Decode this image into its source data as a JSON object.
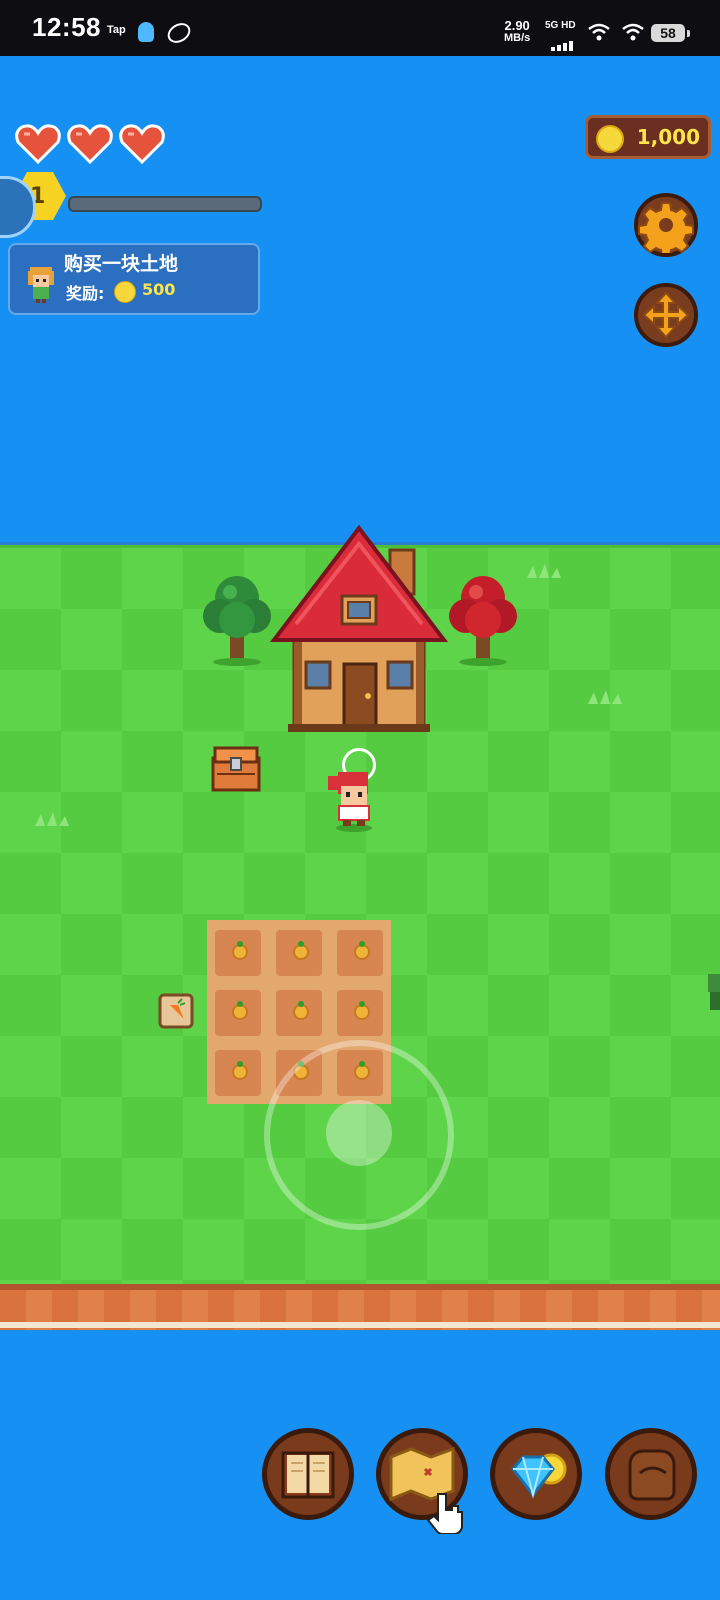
{
  "status_bar": {
    "time": "12:58",
    "tap_label": "Tap",
    "net_speed_value": "2.90",
    "net_speed_unit": "MB/s",
    "signal_label": "5G HD",
    "battery": "58"
  },
  "hud": {
    "hearts": 3,
    "level": "1",
    "xp_progress": 0,
    "coins": "1,000"
  },
  "quest": {
    "title": "购买一块土地",
    "reward_label": "奖励:",
    "reward_amount": "500"
  },
  "colors": {
    "water": "#1690f2",
    "grass": "#5ed44a",
    "soil": "#e2a86e",
    "coin": "#f7d83a",
    "button_wood": "#7a3b1d"
  },
  "side_buttons": [
    {
      "icon": "gear-icon",
      "name": "settings-button"
    },
    {
      "icon": "move-arrows-icon",
      "name": "move-button"
    }
  ],
  "dock": [
    {
      "icon": "book-icon",
      "name": "book-button"
    },
    {
      "icon": "map-icon",
      "name": "map-button"
    },
    {
      "icon": "diamond-coin-icon",
      "name": "shop-button"
    },
    {
      "icon": "bag-icon",
      "name": "inventory-button"
    }
  ],
  "plot": {
    "rows": 3,
    "cols": 3,
    "crop": "carrot"
  }
}
